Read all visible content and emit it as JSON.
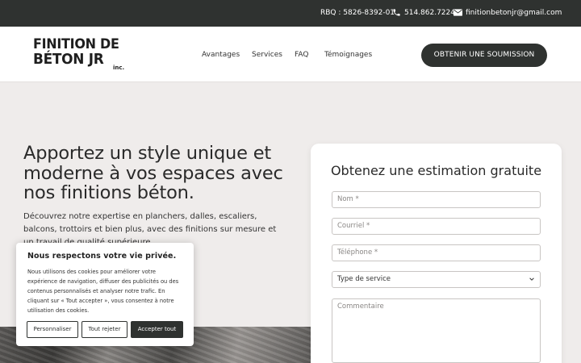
{
  "topbar": {
    "rbq": "RBQ : 5826-8392-01",
    "phone": "514.862.7224",
    "email": "finitionbetonjr@gmail.com",
    "phone_icon": "phone-icon",
    "email_icon": "envelope-icon"
  },
  "header": {
    "logo": {
      "line1": "FINITION DE",
      "line2": "BÉTON JR",
      "line3": "inc."
    },
    "nav": [
      "Avantages",
      "Services",
      "FAQ",
      "Témoignages"
    ],
    "cta": "OBTENIR UNE SOUMISSION"
  },
  "hero": {
    "title": "Apportez un style unique et moderne  à vos espaces avec nos finitions béton.",
    "description": "Découvrez notre expertise en planchers, dalles, escaliers, balcons, trottoirs  et bien plus, avec des finitions sur mesure et un travail de qualité supérieure."
  },
  "form": {
    "title": "Obtenez une estimation gratuite",
    "fields": {
      "name_placeholder": "Nom *",
      "email_placeholder": "Courriel *",
      "phone_placeholder": "Téléphone *",
      "service_selected": "Type de service",
      "comment_placeholder": "Commentaire"
    }
  },
  "cookie_banner": {
    "title": "Nous respectons votre vie privée.",
    "body": "Nous utilisons des cookies pour améliorer votre expérience de navigation, diffuser des publicités ou des contenus personnalisés et analyser notre trafic. En cliquant sur « Tout accepter », vous consentez à notre utilisation des cookies.",
    "customize": "Personnaliser",
    "reject": "Tout rejeter",
    "accept": "Accepter tout"
  },
  "colors": {
    "dark": "#2f3230",
    "page_bg": "#efeceb",
    "card_bg": "#ffffff"
  }
}
